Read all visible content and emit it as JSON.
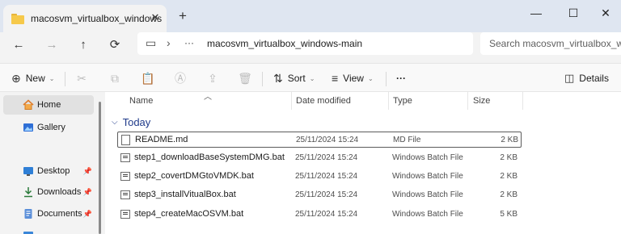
{
  "tab": {
    "title": "macosvm_virtualbox_windows",
    "close": "✕",
    "new": "+"
  },
  "window": {
    "minimize": "—",
    "maximize": "☐",
    "close": "✕"
  },
  "nav": {
    "back": "←",
    "forward": "→",
    "up": "↑",
    "refresh": "⟳",
    "pc_icon": "▭",
    "chevron": "›",
    "ellipsis": "···",
    "path": "macosvm_virtualbox_windows-main",
    "search_placeholder": "Search macosvm_virtualbox_win"
  },
  "commands": {
    "new": "New",
    "sort": "Sort",
    "view": "View",
    "more": "···",
    "details": "Details"
  },
  "sidebar": {
    "items": [
      {
        "label": "Home",
        "icon": "home-icon"
      },
      {
        "label": "Gallery",
        "icon": "gallery-icon"
      },
      {
        "label": "Desktop",
        "icon": "desktop-icon",
        "pinned": true
      },
      {
        "label": "Downloads",
        "icon": "download-icon",
        "pinned": true
      },
      {
        "label": "Documents",
        "icon": "documents-icon",
        "pinned": true
      }
    ]
  },
  "columns": {
    "name": "Name",
    "date": "Date modified",
    "type": "Type",
    "size": "Size"
  },
  "group": {
    "label": "Today"
  },
  "files": [
    {
      "name": "README.md",
      "date": "25/11/2024 15:24",
      "type": "MD File",
      "size": "2 KB"
    },
    {
      "name": "step1_downloadBaseSystemDMG.bat",
      "date": "25/11/2024 15:24",
      "type": "Windows Batch File",
      "size": "2 KB"
    },
    {
      "name": "step2_covertDMGtoVMDK.bat",
      "date": "25/11/2024 15:24",
      "type": "Windows Batch File",
      "size": "2 KB"
    },
    {
      "name": "step3_installVitualBox.bat",
      "date": "25/11/2024 15:24",
      "type": "Windows Batch File",
      "size": "2 KB"
    },
    {
      "name": "step4_createMacOSVM.bat",
      "date": "25/11/2024 15:24",
      "type": "Windows Batch File",
      "size": "5 KB"
    }
  ]
}
